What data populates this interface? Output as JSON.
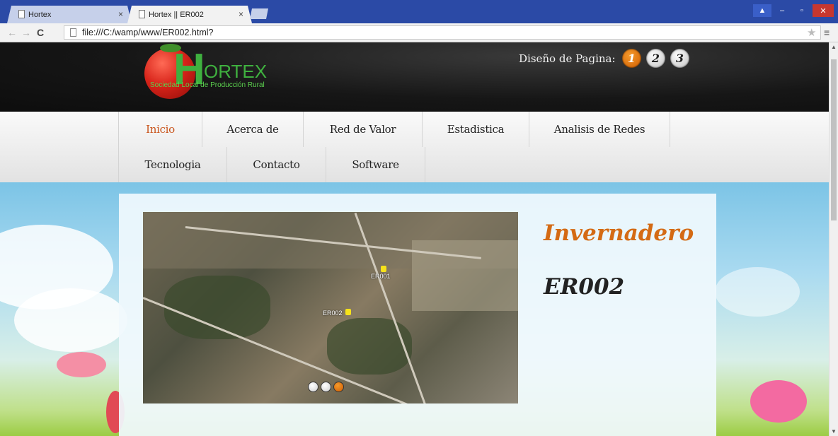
{
  "browser": {
    "tabs": [
      {
        "title": "Hortex",
        "active": false
      },
      {
        "title": "Hortex || ER002",
        "active": true
      }
    ],
    "address": "file:///C:/wamp/www/ER002.html?"
  },
  "header": {
    "logo_letter": "H",
    "logo_word": "ORTEX",
    "logo_subtitle": "Sociedad Local de Producción Rural",
    "design_label": "Diseño de Pagina:",
    "design_buttons": [
      "1",
      "2",
      "3"
    ],
    "design_active": "1"
  },
  "nav": {
    "row1": [
      "Inicio",
      "Acerca de",
      "Red de Valor",
      "Estadistica",
      "Analisis de Redes"
    ],
    "row2": [
      "Tecnologia",
      "Contacto",
      "Software"
    ],
    "active": "Inicio"
  },
  "content": {
    "title": "Invernadero",
    "subtitle": "ER002",
    "map_labels": [
      "ER001",
      "ER002"
    ],
    "slider_dots": 3,
    "slider_active": 3
  },
  "colors": {
    "accent": "#d46a14",
    "nav_active": "#c9531a",
    "logo_green": "#3fb03f",
    "tab_bar": "#2b4aa6"
  }
}
